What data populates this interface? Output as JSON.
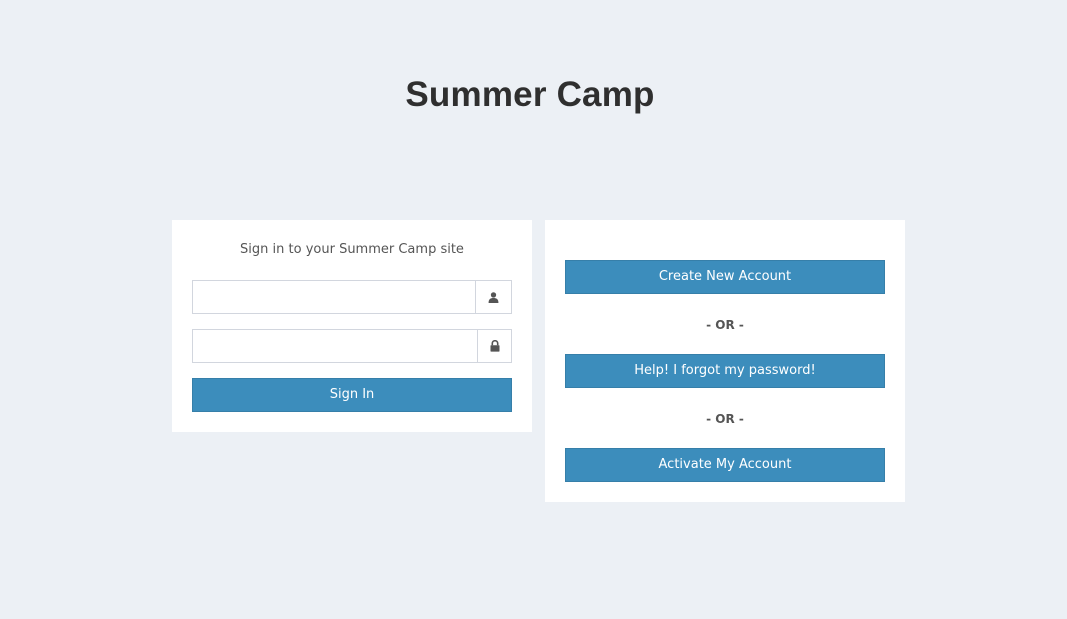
{
  "header": {
    "title": "Summer Camp"
  },
  "login": {
    "message": "Sign in to your Summer Camp site",
    "username": {
      "value": "",
      "placeholder": "",
      "icon": "user-icon"
    },
    "password": {
      "value": "",
      "placeholder": "",
      "icon": "lock-icon"
    },
    "signin_label": "Sign In"
  },
  "actions": {
    "create_label": "Create New Account",
    "separator_1": "- OR -",
    "forgot_label": "Help! I forgot my password!",
    "separator_2": "- OR -",
    "activate_label": "Activate My Account"
  },
  "colors": {
    "background": "#ecf0f5",
    "panel": "#ffffff",
    "button": "#3c8dbc",
    "button_border": "#367fa9",
    "icon": "#555555"
  }
}
